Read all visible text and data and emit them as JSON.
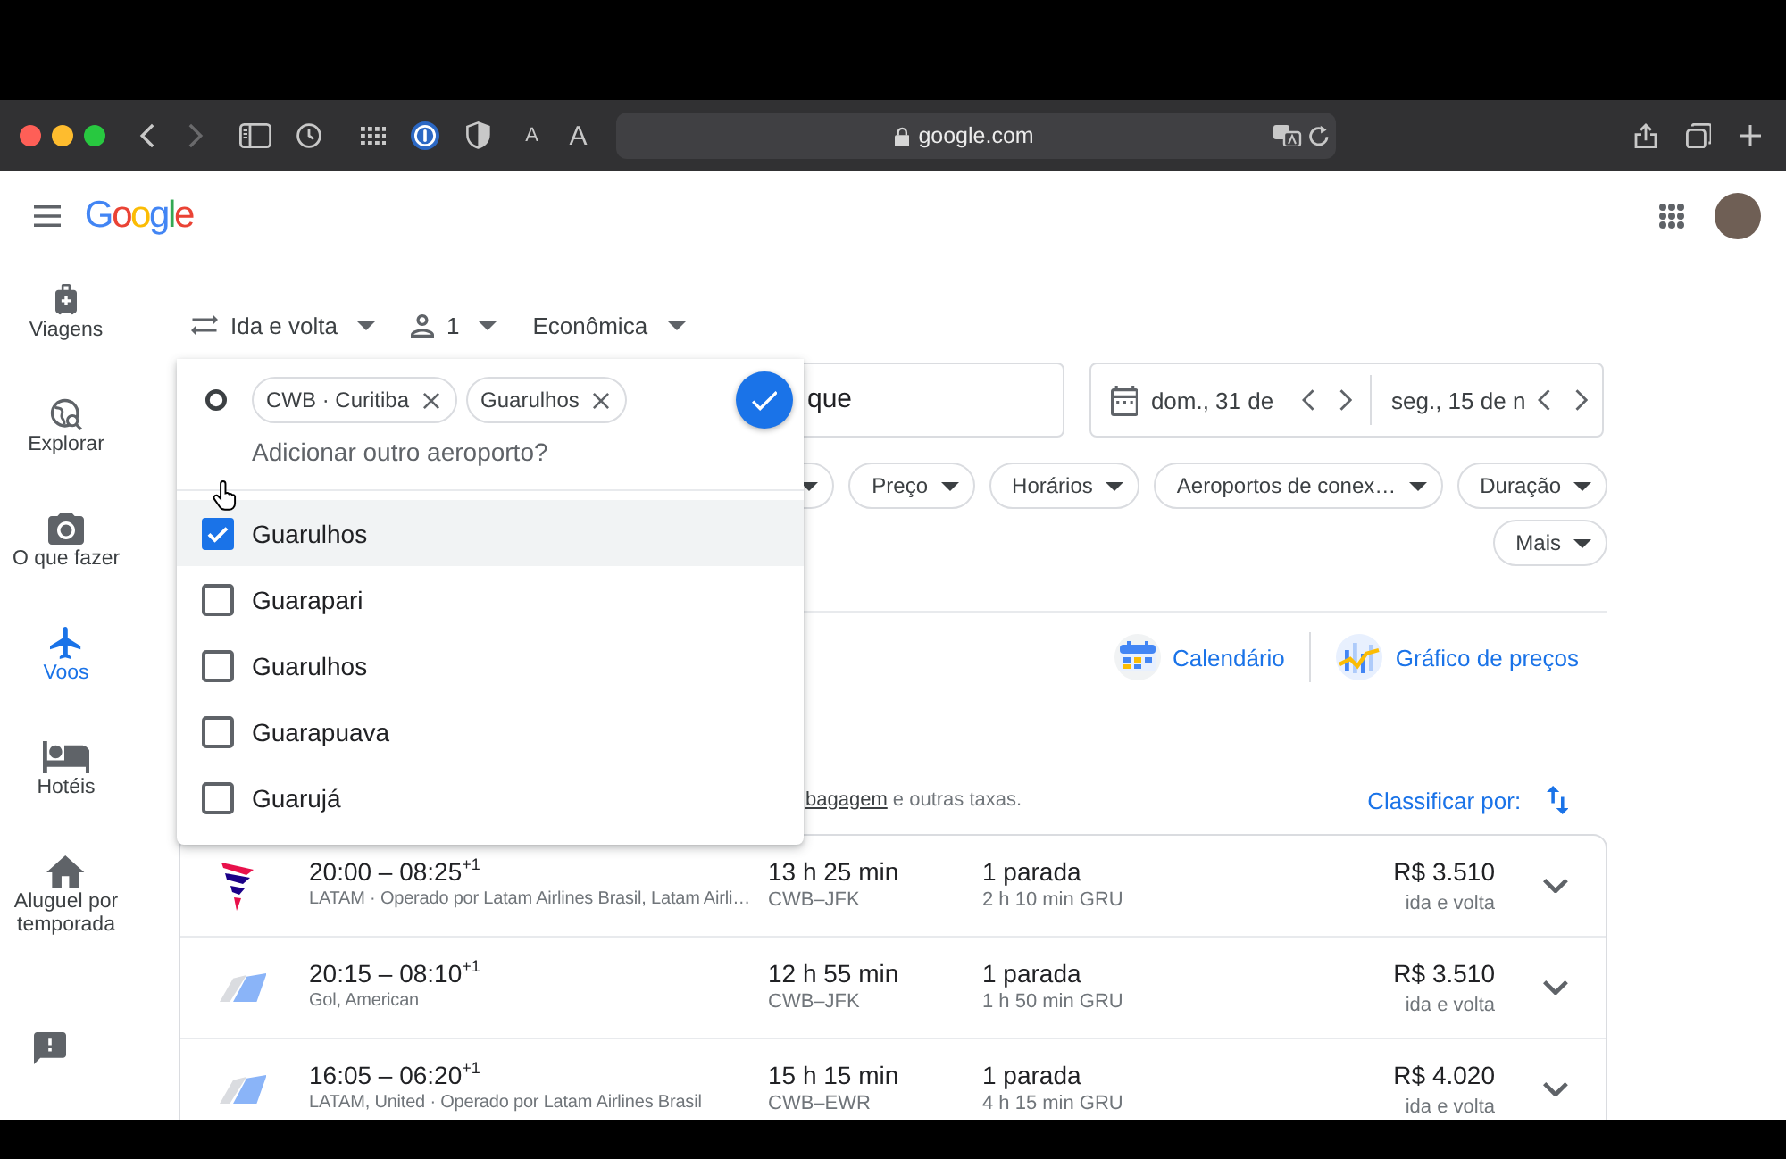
{
  "browser": {
    "url": "google.com",
    "text_size_buttons": [
      {
        "label": "A"
      },
      {
        "label": "A"
      }
    ]
  },
  "header": {
    "logo": "Google"
  },
  "nav": [
    {
      "label": "Viagens",
      "selected": false
    },
    {
      "label": "Explorar",
      "selected": false
    },
    {
      "label": "O que fazer",
      "selected": false
    },
    {
      "label": "Voos",
      "selected": true
    },
    {
      "label": "Hotéis",
      "selected": false
    },
    {
      "label": "Aluguel por temporada",
      "selected": false
    }
  ],
  "trip_options": [
    {
      "label": "Ida e volta"
    },
    {
      "label": "1"
    },
    {
      "label": "Econômica"
    }
  ],
  "destination": {
    "value": "que"
  },
  "dates": [
    {
      "value": "dom., 31 de"
    },
    {
      "value": "seg., 15 de n"
    }
  ],
  "filters": [
    {
      "kind": "covered"
    },
    {
      "kind": "chip",
      "label": "Preço"
    },
    {
      "kind": "chip",
      "label": "Horários"
    },
    {
      "kind": "chip",
      "label": "Aeroportos de conex…"
    },
    {
      "kind": "chip",
      "label": "Duração"
    }
  ],
  "more_filters": {
    "label": "Mais"
  },
  "views": [
    {
      "label": "Calendário"
    },
    {
      "label": "Gráfico de preços"
    }
  ],
  "fare_note": {
    "link": "bagagem",
    "text": " e outras taxas."
  },
  "sort": {
    "label": "Classificar por:"
  },
  "flights": [
    {
      "kind": "single",
      "times": "20:00 – 08:25$^{+1}$",
      "airline": "LATAM · Operado por Latam Airlines Brasil, Latam Airli…",
      "duration": "13 h 25 min",
      "route": "CWB–JFK",
      "stops": "1 parada",
      "layover": "2 h 10 min GRU",
      "price": "R$ 3.510",
      "price_note": "ida e volta"
    },
    {
      "kind": "multi",
      "times": "20:15 – 08:10$^{+1}$",
      "airline": "Gol, American",
      "duration": "12 h 55 min",
      "route": "CWB–JFK",
      "stops": "1 parada",
      "layover": "1 h 50 min GRU",
      "price": "R$ 3.510",
      "price_note": "ida e volta"
    },
    {
      "kind": "multi",
      "times": "16:05 – 06:20$^{+1}$",
      "airline": "LATAM, United · Operado por Latam Airlines Brasil",
      "duration": "15 h 15 min",
      "route": "CWB–EWR",
      "stops": "1 parada",
      "layover": "4 h 15 min GRU",
      "price": "R$ 4.020",
      "price_note": "ida e volta"
    }
  ],
  "airport_picker": {
    "chips": [
      {
        "label": "CWB · Curitiba"
      },
      {
        "label": "Guarulhos"
      }
    ],
    "placeholder": "Adicionar outro aeroporto?",
    "options": [
      {
        "label": "Guarulhos",
        "checked": true,
        "focused": true
      },
      {
        "label": "Guarapari",
        "checked": false,
        "focused": false
      },
      {
        "label": "Guarulhos",
        "checked": false,
        "focused": false
      },
      {
        "label": "Guarapuava",
        "checked": false,
        "focused": false
      },
      {
        "label": "Guarujá",
        "checked": false,
        "focused": false
      }
    ]
  }
}
